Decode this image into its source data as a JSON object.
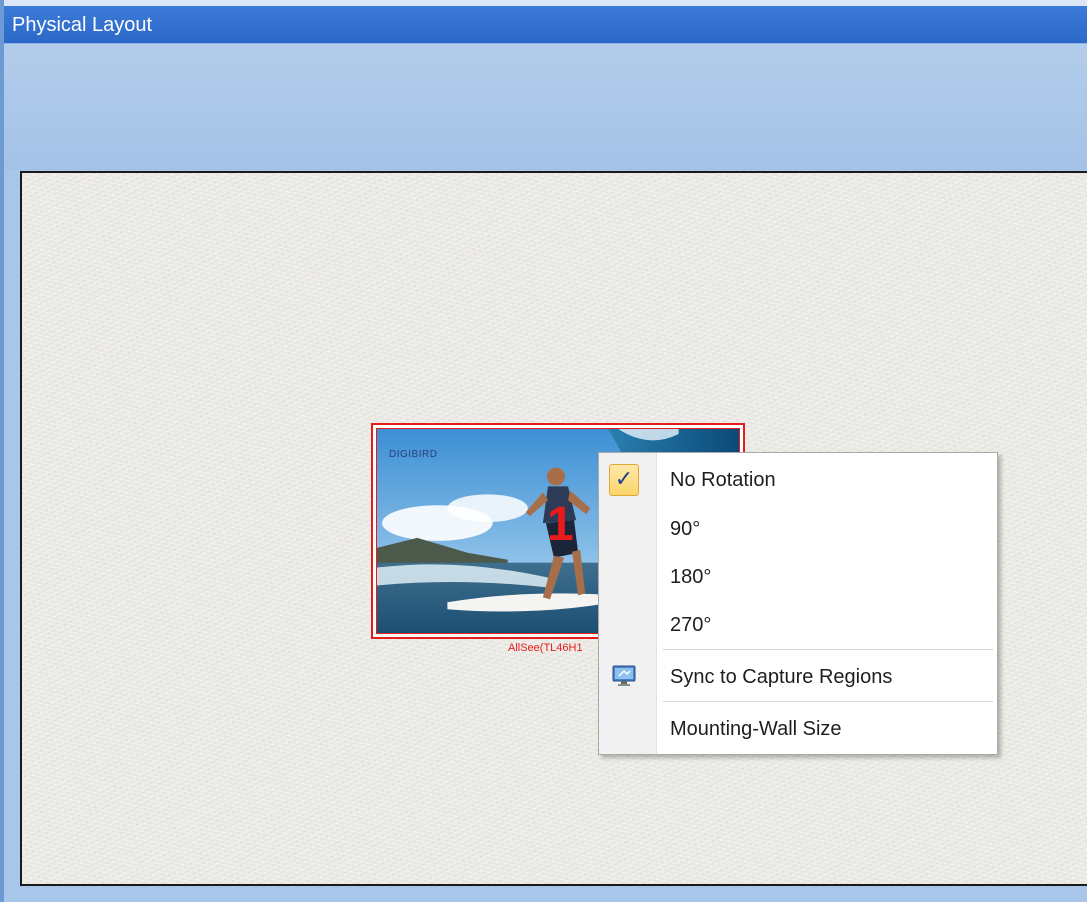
{
  "window": {
    "title": "Physical Layout"
  },
  "display": {
    "brand": "DIGIBIRD",
    "number": "1",
    "caption": "AllSee(TL46H1"
  },
  "context_menu": {
    "items": [
      {
        "label": "No Rotation",
        "checked": true,
        "icon": "checkmark-icon"
      },
      {
        "label": "90°",
        "checked": false
      },
      {
        "label": "180°",
        "checked": false
      },
      {
        "label": "270°",
        "checked": false
      },
      {
        "label": "Sync to Capture Regions",
        "icon": "monitor-sync-icon"
      },
      {
        "label": "Mounting-Wall Size"
      }
    ],
    "check_glyph": "✓"
  },
  "colors": {
    "title_bar": "#2f6ecd",
    "frame": "#a7c6ea",
    "selection_red": "#e81b1b",
    "check_highlight": "#fbd46b"
  }
}
